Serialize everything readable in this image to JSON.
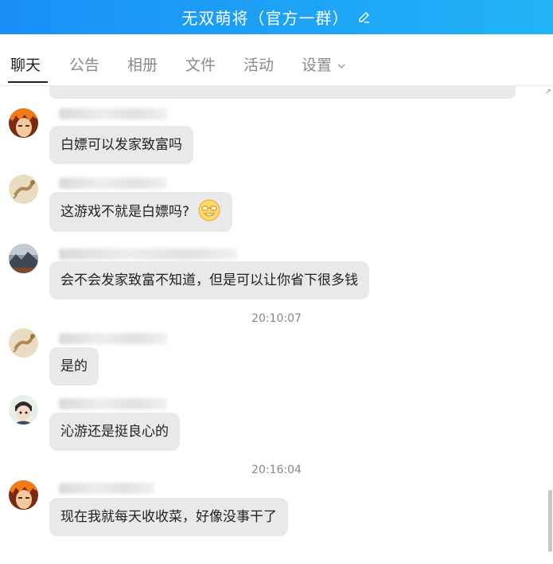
{
  "header": {
    "title": "无双萌将（官方一群）",
    "edit_icon": "edit-pencil-icon"
  },
  "tabs": [
    {
      "label": "聊天",
      "active": true
    },
    {
      "label": "公告",
      "active": false
    },
    {
      "label": "相册",
      "active": false
    },
    {
      "label": "文件",
      "active": false
    },
    {
      "label": "活动",
      "active": false
    },
    {
      "label": "设置",
      "active": false
    }
  ],
  "messages": [
    {
      "avatar": "orange-hair-anime-avatar",
      "text": "白嫖可以发家致富吗"
    },
    {
      "avatar": "lizard-avatar",
      "text": "这游戏不就是白嫖吗?",
      "emoji": "grinning-glasses-emoji-icon"
    },
    {
      "avatar": "mountain-landscape-avatar",
      "text": "会不会发家致富不知道，但是可以让你省下很多钱"
    },
    {
      "avatar": "lizard-avatar",
      "text": "是的"
    },
    {
      "avatar": "cartoon-character-avatar",
      "text": "沁游还是挺良心的"
    },
    {
      "avatar": "orange-hair-anime-avatar",
      "text": "现在我就每天收收菜，好像没事干了"
    }
  ],
  "timestamps": [
    "20:10:07",
    "20:16:04"
  ],
  "colors": {
    "header_gradient_start": "#1a8ff7",
    "header_gradient_end": "#21b4f5",
    "bubble": "#e9e9e9"
  }
}
